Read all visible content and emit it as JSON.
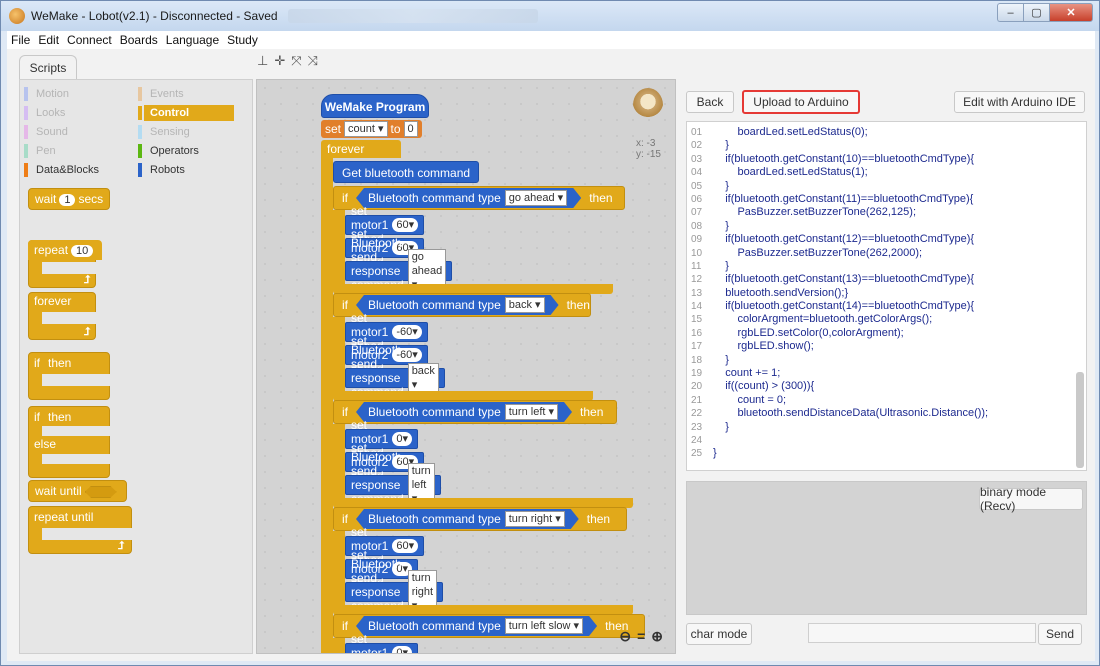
{
  "window": {
    "title": "WeMake - Lobot(v2.1) - Disconnected - Saved",
    "controls": {
      "minimize": "–",
      "maximize": "▢",
      "close": "✕"
    }
  },
  "menu": [
    "File",
    "Edit",
    "Connect",
    "Boards",
    "Language",
    "Study"
  ],
  "tabs": {
    "scripts": "Scripts"
  },
  "toolbar_icons": [
    "stamp-icon",
    "move-icon",
    "grow-icon",
    "shrink-icon"
  ],
  "categories": [
    {
      "label": "Motion",
      "color": "#4a6cd4"
    },
    {
      "label": "Events",
      "color": "#c88330"
    },
    {
      "label": "Looks",
      "color": "#8a55d7"
    },
    {
      "label": "Control",
      "color": "#e1a91a"
    },
    {
      "label": "Sound",
      "color": "#bb42c3"
    },
    {
      "label": "Sensing",
      "color": "#2ca5e2"
    },
    {
      "label": "Pen",
      "color": "#0e9a6c"
    },
    {
      "label": "Operators",
      "color": "#5cb712"
    },
    {
      "label": "Data&Blocks",
      "color": "#ee7d16"
    },
    {
      "label": "Robots",
      "color": "#2b63c9"
    }
  ],
  "palette_blocks": {
    "wait": "wait",
    "wait_value": "1",
    "wait_unit": "secs",
    "repeat": "repeat",
    "repeat_value": "10",
    "forever": "forever",
    "if_then_if": "if",
    "if_then_then": "then",
    "if_else_if": "if",
    "if_else_then": "then",
    "if_else_else": "else",
    "wait_until": "wait until",
    "repeat_until": "repeat until"
  },
  "script": {
    "hat": "WeMake Program",
    "set_label": "set",
    "set_var": "count ▾",
    "set_to": "to",
    "set_value": "0",
    "forever": "forever",
    "get_bt": "Get bluetooth command",
    "if_label": "if",
    "then_label": "then",
    "cond_prefix": "Bluetooth command type",
    "motor1": "set motor1 speed",
    "motor2": "set motor2 speed",
    "response": "Bluetooth send response command type",
    "blocks": [
      {
        "cmd": "go ahead ▾",
        "m1": "60▾",
        "m2": "60▾",
        "resp": "go ahead ▾"
      },
      {
        "cmd": "back ▾",
        "m1": "-60▾",
        "m2": "-60▾",
        "resp": "back ▾"
      },
      {
        "cmd": "turn left ▾",
        "m1": "0▾",
        "m2": "60▾",
        "resp": "turn left ▾"
      },
      {
        "cmd": "turn right ▾",
        "m1": "60▾",
        "m2": "0▾",
        "resp": "turn right ▾"
      },
      {
        "cmd": "turn left slow ▾",
        "m1": "0▾"
      }
    ],
    "sprite_x": "x: -3",
    "sprite_y": "y: -15"
  },
  "right_panel": {
    "back": "Back",
    "upload": "Upload to Arduino",
    "edit_ide": "Edit with Arduino IDE",
    "code_lines": [
      {
        "n": "01",
        "t": "        boardLed.setLedStatus(0);"
      },
      {
        "n": "02",
        "t": "    }"
      },
      {
        "n": "03",
        "t": "    if(bluetooth.getConstant(10)==bluetoothCmdType){"
      },
      {
        "n": "04",
        "t": "        boardLed.setLedStatus(1);"
      },
      {
        "n": "05",
        "t": "    }"
      },
      {
        "n": "06",
        "t": "    if(bluetooth.getConstant(11)==bluetoothCmdType){"
      },
      {
        "n": "07",
        "t": "        PasBuzzer.setBuzzerTone(262,125);"
      },
      {
        "n": "08",
        "t": "    }"
      },
      {
        "n": "09",
        "t": "    if(bluetooth.getConstant(12)==bluetoothCmdType){"
      },
      {
        "n": "10",
        "t": "        PasBuzzer.setBuzzerTone(262,2000);"
      },
      {
        "n": "11",
        "t": "    }"
      },
      {
        "n": "12",
        "t": "    if(bluetooth.getConstant(13)==bluetoothCmdType){"
      },
      {
        "n": "13",
        "t": "    bluetooth.sendVersion();}"
      },
      {
        "n": "14",
        "t": "    if(bluetooth.getConstant(14)==bluetoothCmdType){"
      },
      {
        "n": "15",
        "t": "        colorArgment=bluetooth.getColorArgs();"
      },
      {
        "n": "16",
        "t": "        rgbLED.setColor(0,colorArgment);"
      },
      {
        "n": "17",
        "t": "        rgbLED.show();"
      },
      {
        "n": "18",
        "t": "    }"
      },
      {
        "n": "19",
        "t": "    count += 1;"
      },
      {
        "n": "20",
        "t": "    if((count) > (300)){"
      },
      {
        "n": "21",
        "t": "        count = 0;"
      },
      {
        "n": "22",
        "t": "        bluetooth.sendDistanceData(Ultrasonic.Distance());"
      },
      {
        "n": "23",
        "t": "    }"
      },
      {
        "n": "24",
        "t": ""
      },
      {
        "n": "25",
        "t": "}"
      }
    ],
    "binary_mode": "binary mode (Recv)",
    "char_mode": "char mode",
    "send": "Send",
    "send_input_value": ""
  }
}
